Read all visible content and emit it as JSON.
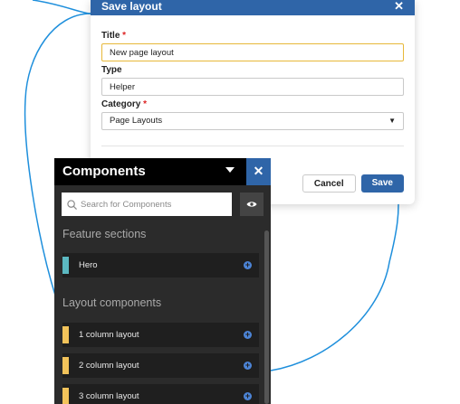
{
  "dialog": {
    "title": "Save layout",
    "fields": {
      "title_label": "Title",
      "title_value": "New page layout",
      "type_label": "Type",
      "type_value": "Helper",
      "category_label": "Category",
      "category_value": "Page Layouts",
      "required_mark": "*"
    },
    "cancel_label": "Cancel",
    "save_label": "Save"
  },
  "components": {
    "title": "Components",
    "search_placeholder": "Search for Components",
    "sections": [
      {
        "title": "Feature sections",
        "items": [
          {
            "label": "Hero",
            "color": "#5bb8c1"
          }
        ]
      },
      {
        "title": "Layout components",
        "items": [
          {
            "label": "1 column layout",
            "color": "#f2c35a"
          },
          {
            "label": "2 column layout",
            "color": "#f2c35a"
          },
          {
            "label": "3 column layout",
            "color": "#f2c35a"
          }
        ]
      }
    ]
  },
  "colors": {
    "accent": "#2f65a8",
    "focus_border": "#e7b839",
    "panel_bg": "#2b2b2b",
    "curve": "#1e8fdc"
  }
}
